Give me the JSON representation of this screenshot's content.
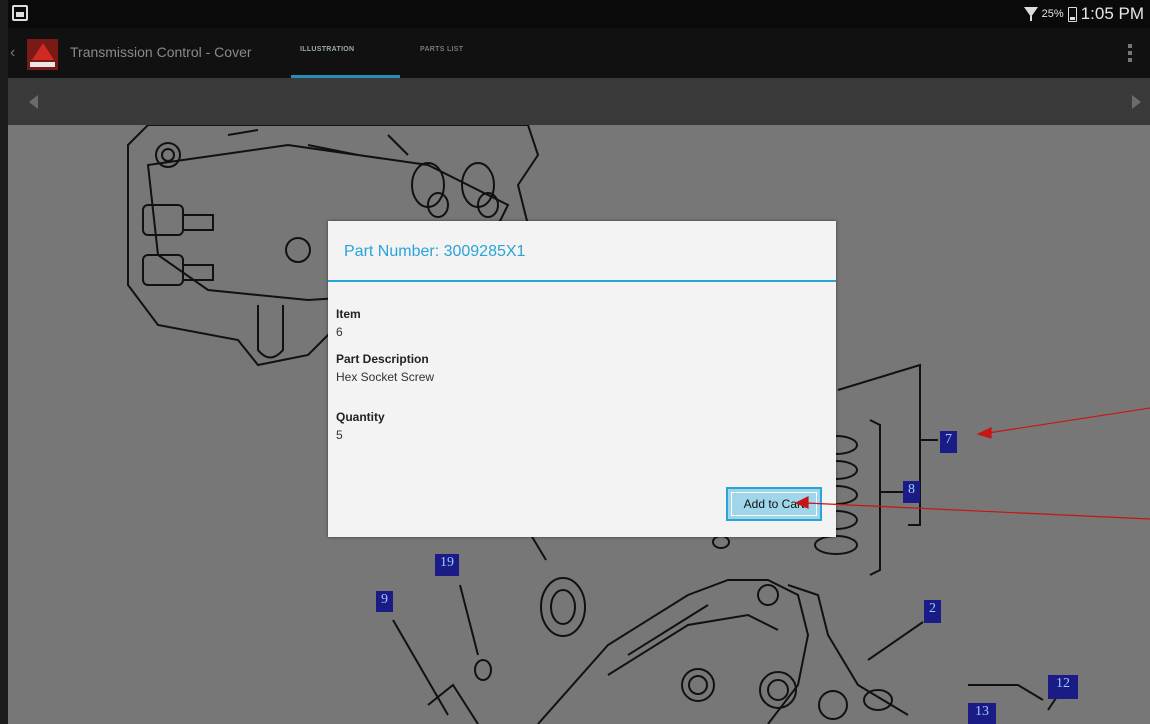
{
  "status_bar": {
    "battery_percent": "25%",
    "time": "1:05 PM"
  },
  "action_bar": {
    "title": "Transmission Control - Cover",
    "tabs": [
      {
        "label": "ILLUSTRATION",
        "selected": true
      },
      {
        "label": "PARTS LIST",
        "selected": false
      }
    ],
    "accent_color": "#2aa3d8"
  },
  "illustration": {
    "callouts": [
      "7",
      "8",
      "19",
      "9",
      "2",
      "12",
      "13"
    ]
  },
  "dialog": {
    "title": "Part Number: 3009285X1",
    "fields": [
      {
        "label": "Item",
        "value": "6"
      },
      {
        "label": "Part Description",
        "value": "Hex Socket Screw"
      },
      {
        "label": "Quantity",
        "value": "5"
      }
    ],
    "add_to_cart_label": "Add to Cart"
  }
}
